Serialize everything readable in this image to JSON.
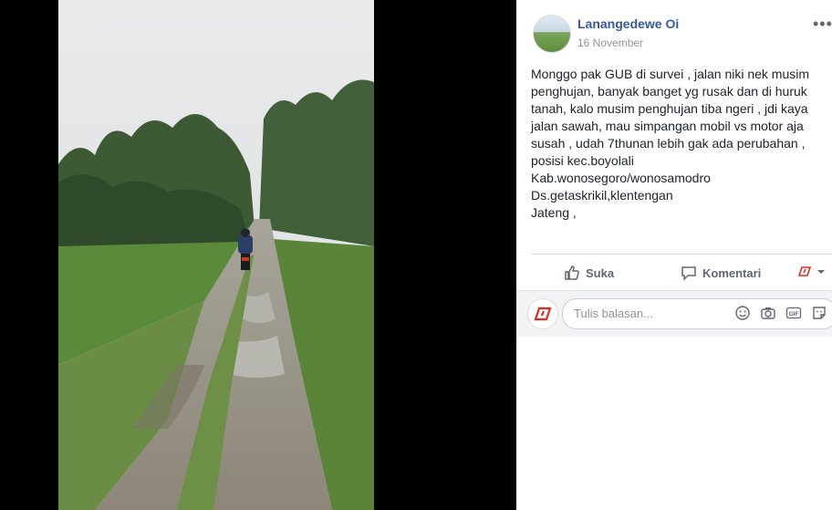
{
  "post": {
    "author": "Lanangedewe Oi",
    "date": "16 November",
    "text_lines": [
      "Monggo pak GUB di survei , jalan niki nek musim",
      "penghujan, banyak banget yg rusak dan di huruk",
      "tanah, kalo musim penghujan tiba ngeri , jdi kaya",
      "jalan sawah, mau simpangan mobil vs motor aja",
      "susah , udah 7thunan lebih gak ada perubahan ,",
      "posisi kec.boyolali",
      "Kab.wonosegoro/wonosamodro",
      "Ds.getaskrikil,klentengan",
      "Jateng ,"
    ],
    "more_label": "•••"
  },
  "actions": {
    "like_label": "Suka",
    "comment_label": "Komentari"
  },
  "comment_box": {
    "placeholder": "Tulis balasan..."
  },
  "icons": {
    "like": "thumbs-up-icon",
    "comment": "speech-bubble-icon",
    "reactor": "page-avatar-icon",
    "dropdown": "chevron-down-icon",
    "emoji": "emoji-icon",
    "camera": "camera-icon",
    "gif": "gif-icon",
    "sticker": "sticker-icon"
  },
  "colors": {
    "author": "#365899",
    "meta": "#90949c",
    "action": "#606770",
    "brand_red": "#e02b20"
  }
}
